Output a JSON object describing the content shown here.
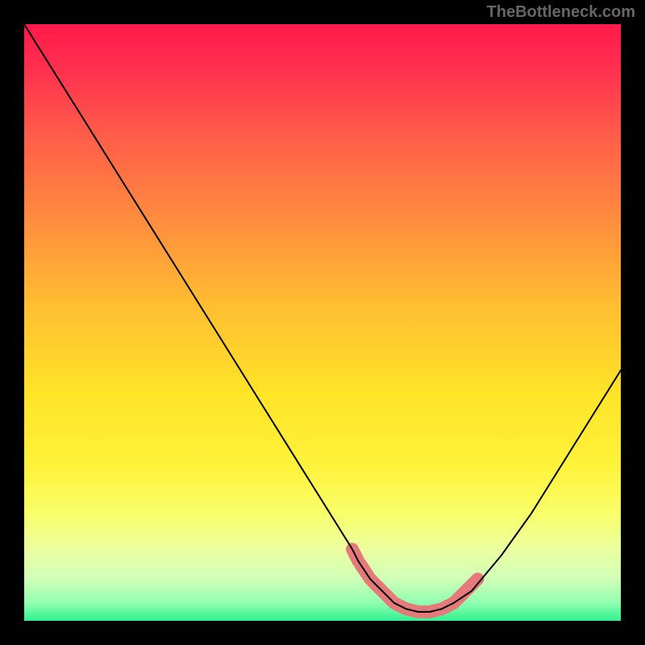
{
  "watermark": "TheBottleneck.com",
  "chart_data": {
    "type": "line",
    "title": "",
    "xlabel": "",
    "ylabel": "",
    "xlim": [
      0,
      100
    ],
    "ylim": [
      0,
      100
    ],
    "series": [
      {
        "name": "bottleneck-curve",
        "x": [
          0,
          5,
          10,
          15,
          20,
          25,
          30,
          35,
          40,
          45,
          50,
          55,
          56,
          58,
          60,
          62,
          64,
          66,
          68,
          70,
          72,
          75,
          80,
          85,
          90,
          95,
          100
        ],
        "values": [
          100,
          92,
          84,
          76,
          68,
          60,
          52,
          44,
          36,
          28,
          20,
          12,
          10,
          7,
          5,
          3,
          2,
          1.5,
          1.5,
          2,
          3,
          5,
          11,
          18,
          26,
          34,
          42
        ]
      },
      {
        "name": "highlight-band-left",
        "x": [
          55,
          56,
          58,
          60
        ],
        "values": [
          12,
          10,
          7,
          5
        ]
      },
      {
        "name": "highlight-band-bottom",
        "x": [
          60,
          62,
          64,
          66,
          68,
          70,
          72
        ],
        "values": [
          5,
          3,
          2,
          1.5,
          1.5,
          2,
          3
        ]
      },
      {
        "name": "highlight-band-right",
        "x": [
          72,
          74,
          76
        ],
        "values": [
          3,
          5,
          7
        ]
      }
    ],
    "gradient_stops": [
      {
        "offset": 0.0,
        "color": "#ff1a4a"
      },
      {
        "offset": 0.07,
        "color": "#ff2e4f"
      },
      {
        "offset": 0.18,
        "color": "#ff5a4a"
      },
      {
        "offset": 0.32,
        "color": "#ff8a3f"
      },
      {
        "offset": 0.48,
        "color": "#ffc030"
      },
      {
        "offset": 0.62,
        "color": "#ffe428"
      },
      {
        "offset": 0.74,
        "color": "#fff23a"
      },
      {
        "offset": 0.82,
        "color": "#f8ff6a"
      },
      {
        "offset": 0.88,
        "color": "#ebffa0"
      },
      {
        "offset": 0.93,
        "color": "#d0ffb8"
      },
      {
        "offset": 0.97,
        "color": "#90ffb0"
      },
      {
        "offset": 1.0,
        "color": "#30f090"
      }
    ],
    "highlight_color": "#e67a7a",
    "curve_color": "#000000"
  }
}
